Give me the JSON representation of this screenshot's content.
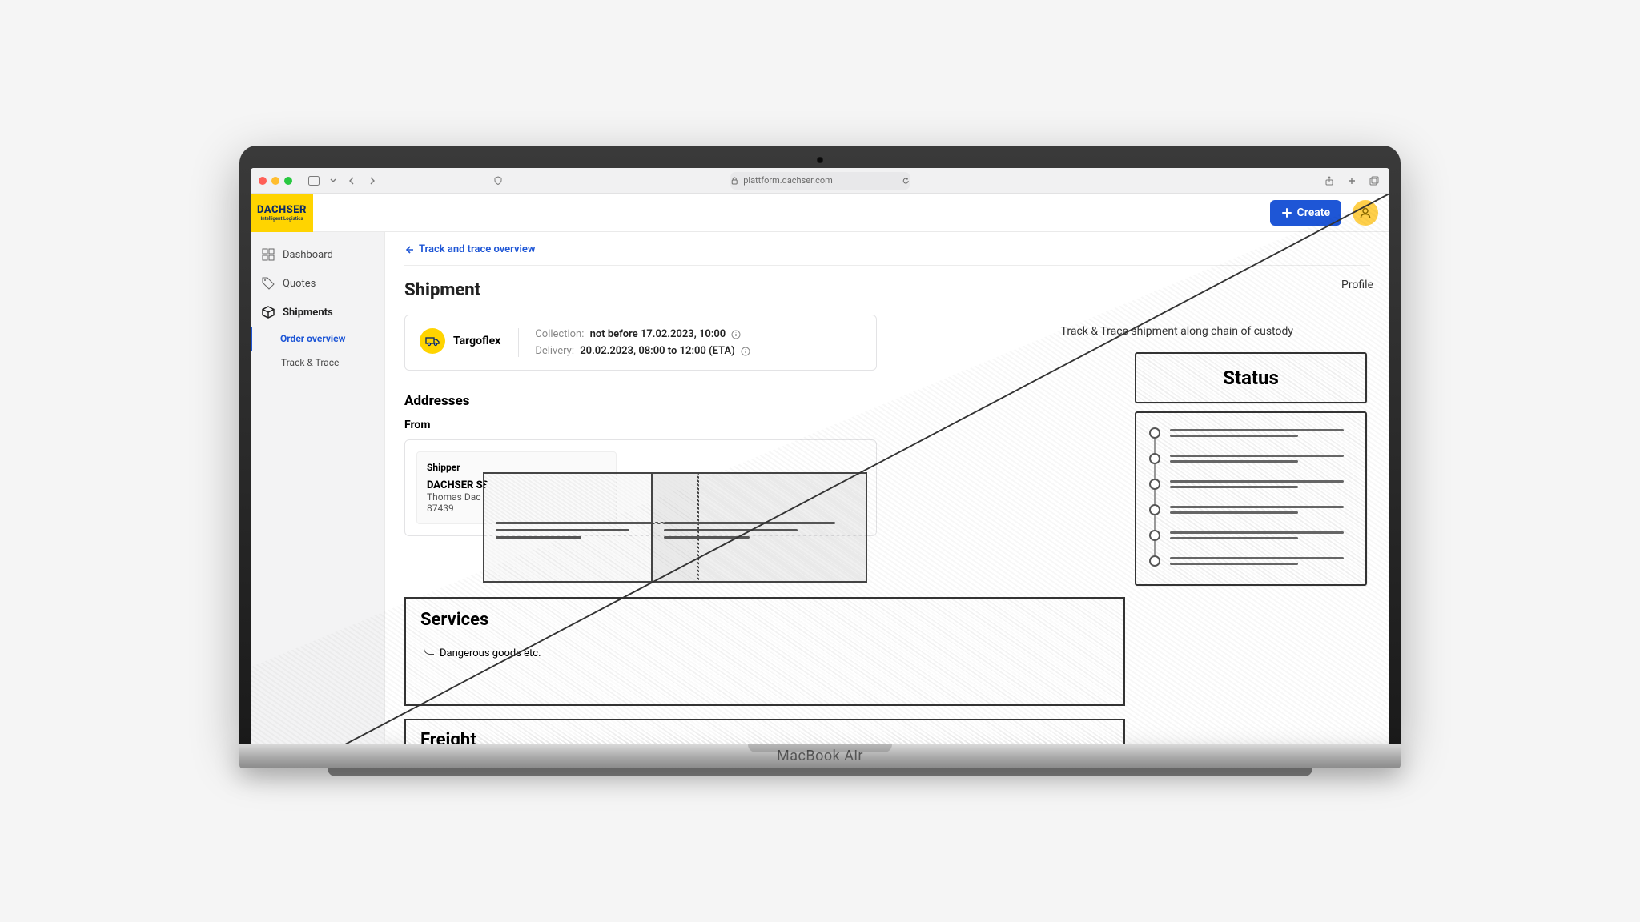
{
  "device_label": "MacBook Air",
  "safari": {
    "url": "plattform.dachser.com"
  },
  "brand": {
    "main": "DACHSER",
    "sub": "Intelligent Logistics"
  },
  "header": {
    "create_label": "Create"
  },
  "profile_annot": "Profile",
  "sidebar": {
    "items": [
      {
        "label": "Dashboard"
      },
      {
        "label": "Quotes"
      },
      {
        "label": "Shipments"
      }
    ],
    "sub": [
      {
        "label": "Order overview"
      },
      {
        "label": "Track & Trace"
      }
    ]
  },
  "main": {
    "back_label": "Track and trace overview",
    "title": "Shipment",
    "carrier": "Targoflex",
    "collection_label": "Collection:",
    "collection_value": "not before 17.02.2023, 10:00",
    "delivery_label": "Delivery:",
    "delivery_value": "20.02.2023, 08:00 to 12:00 (ETA)",
    "addresses_title": "Addresses",
    "from_label": "From",
    "shipper_label": "Shipper",
    "company": "DACHSER SE",
    "contact": "Thomas Dac",
    "postal": "87439"
  },
  "sketch": {
    "status_title": "Status",
    "track_annot": "Track & Trace shipment along chain of custody",
    "services_title": "Services",
    "services_note": "Dangerous goods etc.",
    "freight_title": "Freight"
  }
}
